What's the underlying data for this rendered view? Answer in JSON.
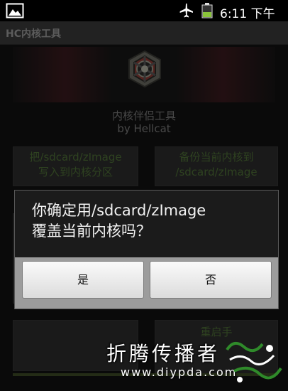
{
  "status_bar": {
    "time": "6:11 下午",
    "icons": [
      "gallery-icon",
      "airplane-mode-icon",
      "battery-icon"
    ],
    "battery_color": "#8ac43a"
  },
  "app": {
    "title": "HC内核工具",
    "caption_line1": "内核伴侣工具",
    "caption_line2": "by Hellcat",
    "background_buttons": {
      "flash": {
        "line1": "把/sdcard/zImage",
        "line2": "写入到内核分区"
      },
      "backup": {
        "line1": "备份当前内核到",
        "line2": "/sdcard/zImage"
      },
      "reboot": {
        "line1": "重启手"
      }
    },
    "accent_text_color": "#4e6f36"
  },
  "dialog": {
    "message_line1": "你确定用/sdcard/zImage",
    "message_line2": "覆盖当前内核吗？",
    "yes_label": "是",
    "no_label": "否"
  },
  "watermark": {
    "chinese": "折腾传播者",
    "url": "www.diypda.com"
  }
}
